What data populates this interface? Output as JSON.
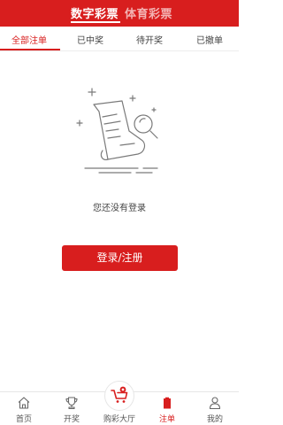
{
  "header": {
    "tabs": [
      {
        "label": "数字彩票",
        "active": true
      },
      {
        "label": "体育彩票",
        "active": false
      }
    ]
  },
  "subtabs": [
    {
      "label": "全部注单",
      "active": true
    },
    {
      "label": "已中奖",
      "active": false
    },
    {
      "label": "待开奖",
      "active": false
    },
    {
      "label": "已撤单",
      "active": false
    }
  ],
  "empty_state": {
    "message": "您还没有登录",
    "icon": "empty-document-search-icon"
  },
  "login_button": {
    "label": "登录/注册"
  },
  "bottom_nav": [
    {
      "label": "首页",
      "icon": "home-icon",
      "active": false
    },
    {
      "label": "开奖",
      "icon": "trophy-icon",
      "active": false
    },
    {
      "label": "购彩大厅",
      "icon": "cart-icon",
      "active": false
    },
    {
      "label": "注单",
      "icon": "bet-slip-icon",
      "active": true
    },
    {
      "label": "我的",
      "icon": "user-icon",
      "active": false
    }
  ],
  "colors": {
    "accent": "#d81e1e",
    "inactive_header_tab": "#f3b3b3"
  }
}
